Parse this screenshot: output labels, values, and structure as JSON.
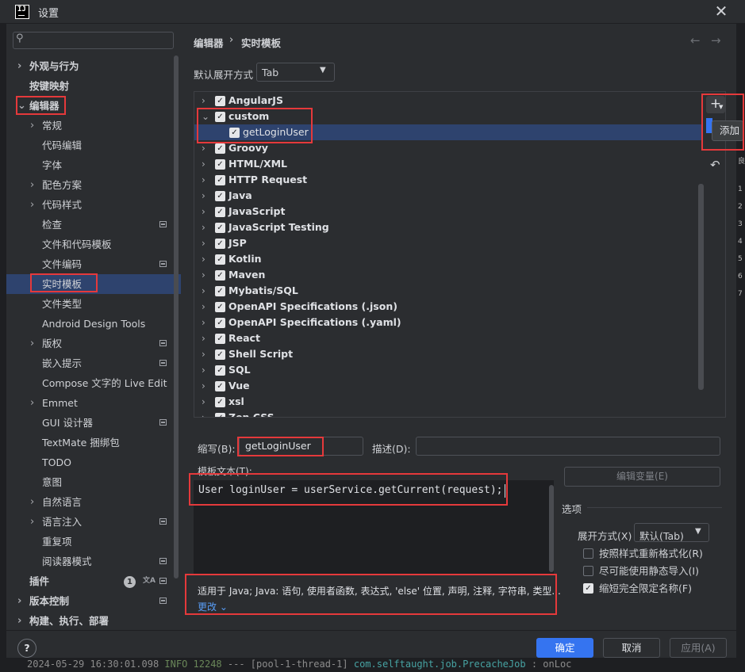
{
  "window": {
    "title": "设置",
    "logo": "IJ",
    "close_icon": "✕"
  },
  "sidebar": {
    "search_icon": "⚲",
    "items": [
      {
        "label": "外观与行为",
        "bold": true,
        "arrow": "›"
      },
      {
        "label": "按键映射",
        "bold": true,
        "arrow": ""
      },
      {
        "label": "编辑器",
        "bold": true,
        "arrow": "⌄"
      },
      {
        "label": "常规",
        "arrow": "›"
      },
      {
        "label": "代码编辑",
        "arrow": ""
      },
      {
        "label": "字体",
        "arrow": ""
      },
      {
        "label": "配色方案",
        "arrow": "›"
      },
      {
        "label": "代码样式",
        "arrow": "›"
      },
      {
        "label": "检查",
        "arrow": "",
        "badge": true
      },
      {
        "label": "文件和代码模板",
        "arrow": ""
      },
      {
        "label": "文件编码",
        "arrow": "",
        "badge": true
      },
      {
        "label": "实时模板",
        "arrow": "",
        "selected": true
      },
      {
        "label": "文件类型",
        "arrow": ""
      },
      {
        "label": "Android Design Tools",
        "arrow": ""
      },
      {
        "label": "版权",
        "arrow": "›",
        "badge": true
      },
      {
        "label": "嵌入提示",
        "arrow": "",
        "badge": true
      },
      {
        "label": "Compose 文字的 Live Edit",
        "arrow": ""
      },
      {
        "label": "Emmet",
        "arrow": "›"
      },
      {
        "label": "GUI 设计器",
        "arrow": "",
        "badge": true
      },
      {
        "label": "TextMate 捆绑包",
        "arrow": ""
      },
      {
        "label": "TODO",
        "arrow": ""
      },
      {
        "label": "意图",
        "arrow": ""
      },
      {
        "label": "自然语言",
        "arrow": "›"
      },
      {
        "label": "语言注入",
        "arrow": "›",
        "badge": true
      },
      {
        "label": "重复项",
        "arrow": ""
      },
      {
        "label": "阅读器模式",
        "arrow": "",
        "badge": true
      },
      {
        "label": "插件",
        "bold": true,
        "arrow": "",
        "count": "1",
        "badge": true
      },
      {
        "label": "版本控制",
        "bold": true,
        "arrow": "›",
        "badge": true
      },
      {
        "label": "构建、执行、部署",
        "bold": true,
        "arrow": "›"
      }
    ]
  },
  "header": {
    "crumb1": "编辑器",
    "sep": "›",
    "crumb2": "实时模板",
    "back": "←",
    "forward": "→"
  },
  "expand": {
    "label": "默认展开方式",
    "value": "Tab"
  },
  "tree": [
    {
      "label": "AngularJS",
      "chev": "›",
      "level": 0
    },
    {
      "label": "custom",
      "chev": "⌄",
      "level": 0
    },
    {
      "label": "getLoginUser",
      "chev": "",
      "level": 1,
      "selected": true
    },
    {
      "label": "Groovy",
      "chev": "›",
      "level": 0
    },
    {
      "label": "HTML/XML",
      "chev": "›",
      "level": 0
    },
    {
      "label": "HTTP Request",
      "chev": "›",
      "level": 0
    },
    {
      "label": "Java",
      "chev": "›",
      "level": 0
    },
    {
      "label": "JavaScript",
      "chev": "›",
      "level": 0
    },
    {
      "label": "JavaScript Testing",
      "chev": "›",
      "level": 0
    },
    {
      "label": "JSP",
      "chev": "›",
      "level": 0
    },
    {
      "label": "Kotlin",
      "chev": "›",
      "level": 0
    },
    {
      "label": "Maven",
      "chev": "›",
      "level": 0
    },
    {
      "label": "Mybatis/SQL",
      "chev": "›",
      "level": 0
    },
    {
      "label": "OpenAPI Specifications (.json)",
      "chev": "›",
      "level": 0
    },
    {
      "label": "OpenAPI Specifications (.yaml)",
      "chev": "›",
      "level": 0
    },
    {
      "label": "React",
      "chev": "›",
      "level": 0
    },
    {
      "label": "Shell Script",
      "chev": "›",
      "level": 0
    },
    {
      "label": "SQL",
      "chev": "›",
      "level": 0
    },
    {
      "label": "Vue",
      "chev": "›",
      "level": 0
    },
    {
      "label": "xsl",
      "chev": "›",
      "level": 0
    },
    {
      "label": "Zen CSS",
      "chev": "›",
      "level": 0
    }
  ],
  "toolbar": {
    "add_icon": "+",
    "add_tooltip": "添加",
    "revert_icon": "↶"
  },
  "abbreviation": {
    "label": "缩写(B):",
    "value": "getLoginUser"
  },
  "description": {
    "label": "描述(D):",
    "value": ""
  },
  "template_text": {
    "label": "模板文本(T):",
    "code": "User loginUser = userService.getCurrent(request);"
  },
  "edit_vars_label": "编辑变量(E)",
  "options": {
    "title": "选项",
    "expand_label": "展开方式(X)",
    "expand_value": "默认(Tab)",
    "checks": [
      {
        "label": "按照样式重新格式化(R)",
        "checked": false
      },
      {
        "label": "尽可能使用静态导入(I)",
        "checked": false
      },
      {
        "label": "缩短完全限定名称(F)",
        "checked": true
      }
    ]
  },
  "context": {
    "text": "适用于 Java; Java: 语句, 使用者函数, 表达式, 'else' 位置, 声明, 注释, 字符串, 类型...",
    "change_label": "更改 ⌄"
  },
  "footer": {
    "help": "?",
    "ok": "确定",
    "cancel": "取消",
    "apply": "应用(A)"
  },
  "background": {
    "console_date": "2024-05-29 16:30:01.098",
    "console_level": "INFO 12248",
    "console_mid": "--- [pool-1-thread-1]",
    "console_class": "com.selftaught.job.PrecacheJob",
    "console_tail": ": onLoc",
    "right_strip": [
      "良",
      "1",
      "2",
      "3",
      "4",
      "5",
      "6",
      "7"
    ]
  }
}
